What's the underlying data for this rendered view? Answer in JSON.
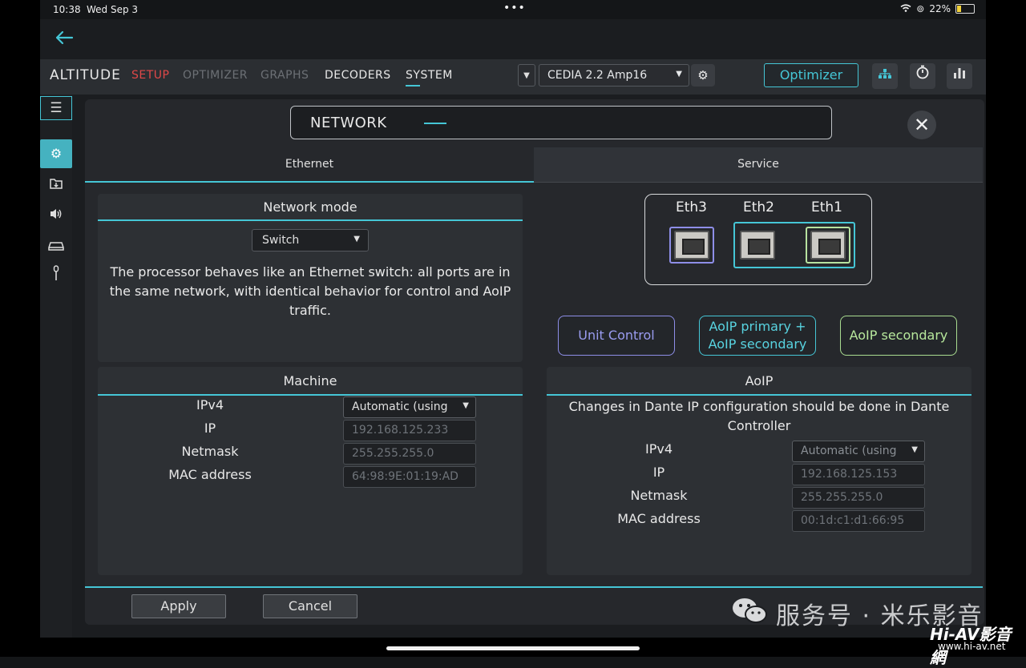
{
  "status_bar": {
    "time": "10:38",
    "date": "Wed Sep 3",
    "dots": "•••",
    "battery": "22%",
    "battery_level": 0.22
  },
  "topnav": {
    "logo": "ALTITUDE",
    "tabs": {
      "setup": "SETUP",
      "optimizer": "OPTIMIZER",
      "graphs": "GRAPHS",
      "decoders": "DECODERS",
      "system": "SYSTEM"
    },
    "preset": "CEDIA 2.2 Amp16",
    "optimizer_button": "Optimizer"
  },
  "modal": {
    "title": "NETWORK",
    "tabs": {
      "ethernet": "Ethernet",
      "service": "Service"
    },
    "network_mode": {
      "header": "Network mode",
      "value": "Switch",
      "description": "The processor behaves like an Ethernet switch: all ports are in the same network, with identical behavior for control and AoIP traffic."
    },
    "ports": {
      "eth3": "Eth3",
      "eth2": "Eth2",
      "eth1": "Eth1"
    },
    "service_buttons": {
      "unit_control": "Unit Control",
      "aoip_primary_line1": "AoIP primary +",
      "aoip_primary_line2": "AoIP secondary",
      "aoip_secondary": "AoIP secondary"
    },
    "machine": {
      "header": "Machine",
      "labels": {
        "ipv4": "IPv4",
        "ip": "IP",
        "netmask": "Netmask",
        "mac": "MAC address"
      },
      "values": {
        "ipv4": "Automatic (using",
        "ip": "192.168.125.233",
        "netmask": "255.255.255.0",
        "mac": "64:98:9E:01:19:AD"
      }
    },
    "aoip": {
      "header": "AoIP",
      "note": "Changes in Dante IP configuration should be done in Dante Controller",
      "labels": {
        "ipv4": "IPv4",
        "ip": "IP",
        "netmask": "Netmask",
        "mac": "MAC address"
      },
      "values": {
        "ipv4": "Automatic (using",
        "ip": "192.168.125.153",
        "netmask": "255.255.255.0",
        "mac": "00:1d:c1:d1:66:95"
      }
    },
    "footer": {
      "apply": "Apply",
      "cancel": "Cancel"
    }
  },
  "watermark": {
    "text": "服务号 · 米乐影音",
    "logo": "Hi-AV影音網",
    "url": "www.hi-av.net"
  },
  "colors": {
    "accent": "#45c6d6",
    "setup_red": "#e04848",
    "unit_control": "#8e8ee8",
    "aoip_secondary": "#a9dc90"
  },
  "icons": {
    "back": "back-arrow-icon",
    "menu": "menu-icon",
    "settings": "settings-gears-icon",
    "import": "import-icon",
    "speakers": "speakers-icon",
    "device": "device-icon",
    "mic": "microphone-icon",
    "network": "network-icon",
    "timer": "timer-icon",
    "levels": "levels-icon",
    "gear": "gear-icon",
    "close": "close-icon"
  }
}
